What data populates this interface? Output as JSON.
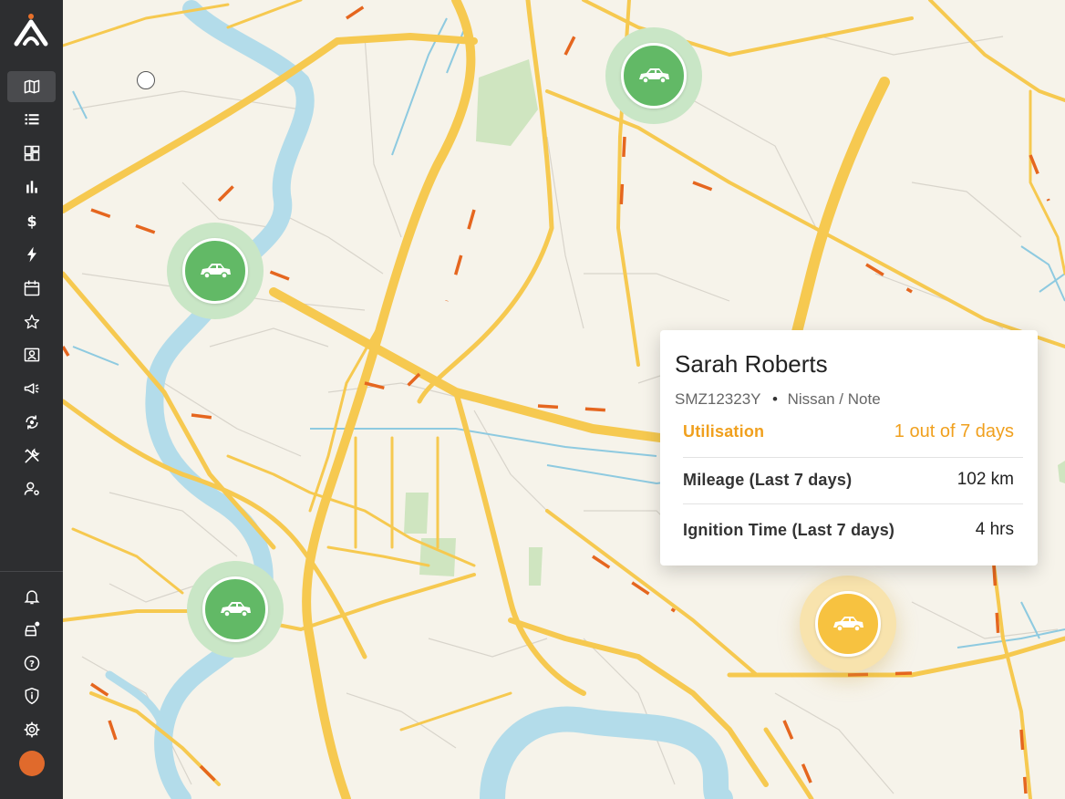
{
  "sidebar": {
    "nav_items": [
      {
        "name": "map-icon",
        "active": true
      },
      {
        "name": "list-icon",
        "active": false
      },
      {
        "name": "dashboard-icon",
        "active": false
      },
      {
        "name": "bar-chart-icon",
        "active": false
      },
      {
        "name": "dollar-icon",
        "active": false
      },
      {
        "name": "lightning-icon",
        "active": false
      },
      {
        "name": "calendar-icon",
        "active": false
      },
      {
        "name": "star-icon",
        "active": false
      },
      {
        "name": "contact-icon",
        "active": false
      },
      {
        "name": "megaphone-icon",
        "active": false
      },
      {
        "name": "sync-location-icon",
        "active": false
      },
      {
        "name": "tools-icon",
        "active": false
      },
      {
        "name": "user-settings-icon",
        "active": false
      }
    ],
    "bottom_items": [
      {
        "name": "bell-icon"
      },
      {
        "name": "vehicle-alert-icon"
      },
      {
        "name": "help-icon"
      },
      {
        "name": "shield-info-icon"
      },
      {
        "name": "gear-icon"
      }
    ],
    "avatar_color": "#e06a2c"
  },
  "colors": {
    "marker_green": "#62b966",
    "marker_green_halo": "#c9e6c6",
    "marker_yellow": "#f7c240",
    "marker_yellow_halo": "#f8e3ad",
    "accent_orange": "#f0a01e"
  },
  "popup": {
    "driver_name": "Sarah Roberts",
    "plate": "SMZ12323Y",
    "separator": "•",
    "vehicle": "Nissan / Note",
    "utilisation_label": "Utilisation",
    "utilisation_value": "1 out of 7 days",
    "mileage_label": "Mileage (Last 7 days)",
    "mileage_value": "102 km",
    "ignition_label": "Ignition Time (Last 7 days)",
    "ignition_value": "4 hrs"
  },
  "markers": [
    {
      "name": "vehicle-marker-north",
      "status": "green",
      "icon": "car-icon"
    },
    {
      "name": "vehicle-marker-west",
      "status": "green",
      "icon": "car-icon"
    },
    {
      "name": "vehicle-marker-southwest",
      "status": "green",
      "icon": "car-icon"
    },
    {
      "name": "vehicle-marker-selected",
      "status": "yellow",
      "icon": "car-icon"
    }
  ]
}
